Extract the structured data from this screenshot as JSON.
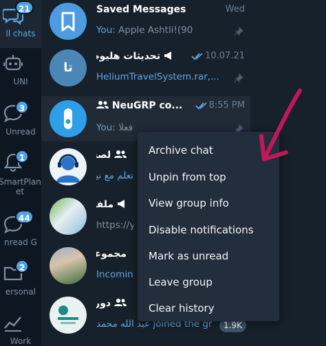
{
  "sidebar": {
    "folders": [
      {
        "label": "ll chats",
        "badge": "21",
        "icon": "chat-bubbles-icon",
        "active": true
      },
      {
        "label": "UNI",
        "badge": "",
        "icon": "robot-icon"
      },
      {
        "label": "Unread",
        "badge": "3",
        "icon": "chat-bubble-icon"
      },
      {
        "label": "SmartPlan et",
        "badge": "1",
        "icon": "bell-icon"
      },
      {
        "label": "nread G",
        "badge": "44",
        "icon": "chat-bubble-icon"
      },
      {
        "label": "ersonal",
        "badge": "2",
        "icon": "folder-icon"
      },
      {
        "label": "Work",
        "badge": "",
        "icon": "chart-icon"
      }
    ]
  },
  "chats": [
    {
      "title": "Saved Messages",
      "time": "Wed",
      "sender": "You:",
      "preview": "Apple Ashtli!(90"
    },
    {
      "title": "تحديثات هليوم",
      "time": "10.07.21",
      "preview": "HeliumTravelSystem.rar,...",
      "avatar_text": "تا"
    },
    {
      "title": "NeuGRP co...",
      "time": "8:55 PM",
      "sender": "You:",
      "preview": "فعلا"
    },
    {
      "title": "لصفحة الأعلى في ل",
      "preview": "تعلم مع نيوترون"
    },
    {
      "title": "ملفات",
      "preview": "https://y"
    },
    {
      "title": "مجموعة نيوترون",
      "preview": "Incomin"
    },
    {
      "title": "دورات قيمة في أ",
      "preview": "عبد الله محمد joined the gr",
      "badge": "1.9K"
    }
  ],
  "context_menu": {
    "items": [
      "Archive chat",
      "Unpin from top",
      "View group info",
      "Disable notifications",
      "Mark as unread",
      "Leave group",
      "Clear history"
    ]
  },
  "colors": {
    "accent": "#5fa8e0",
    "badge": "#4fa3e3",
    "annotation_arrow": "#c2185b",
    "background": "#17212b"
  }
}
